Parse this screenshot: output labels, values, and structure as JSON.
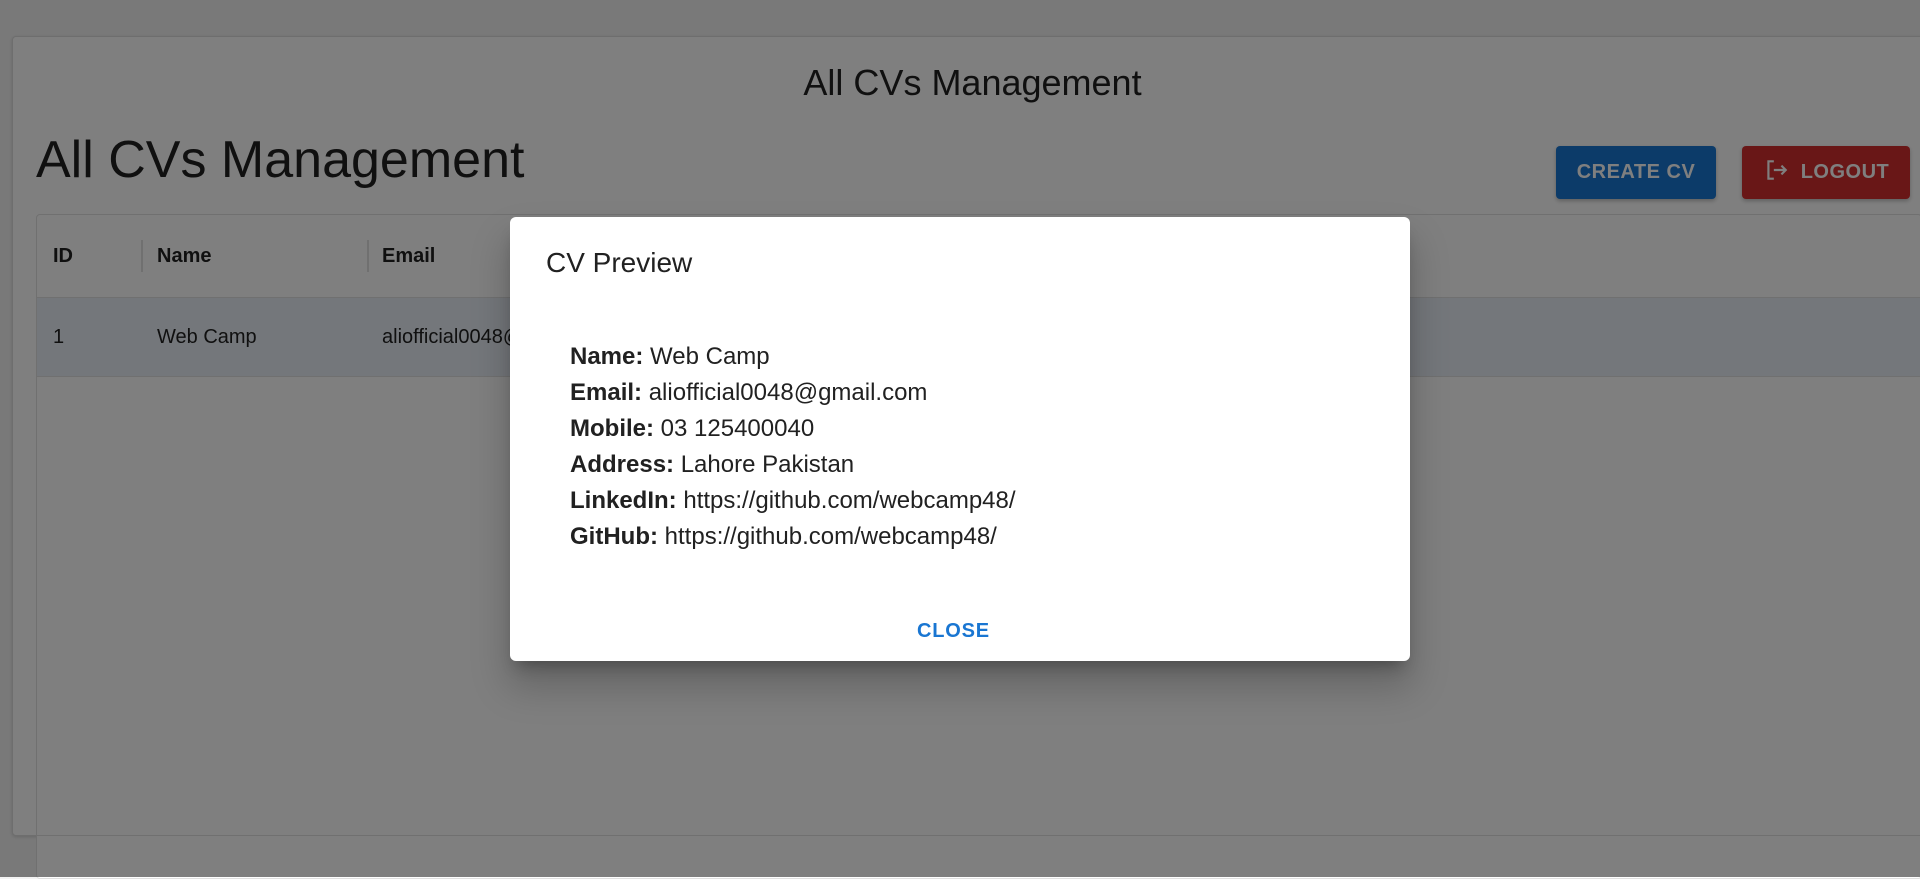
{
  "header": {
    "app_title": "All CVs Management"
  },
  "page": {
    "heading": "All CVs Management"
  },
  "toolbar": {
    "create_label": "CREATE CV",
    "logout_label": "LOGOUT",
    "logout_icon": "logout-icon"
  },
  "table": {
    "columns": [
      "ID",
      "Name",
      "Email"
    ],
    "rows": [
      {
        "id": "1",
        "name": "Web Camp",
        "email": "aliofficial0048@gmail.com"
      }
    ]
  },
  "dialog": {
    "title": "CV Preview",
    "fields": [
      {
        "label": "Name:",
        "value": "Web Camp"
      },
      {
        "label": "Email:",
        "value": "aliofficial0048@gmail.com"
      },
      {
        "label": "Mobile:",
        "value": "03 125400040"
      },
      {
        "label": "Address:",
        "value": "Lahore Pakistan"
      },
      {
        "label": "LinkedIn:",
        "value": "https://github.com/webcamp48/"
      },
      {
        "label": "GitHub:",
        "value": "https://github.com/webcamp48/"
      }
    ],
    "close_label": "CLOSE"
  },
  "colors": {
    "primary": "#1976d2",
    "danger": "#d32f2f",
    "row_selected": "#e8eef6"
  }
}
